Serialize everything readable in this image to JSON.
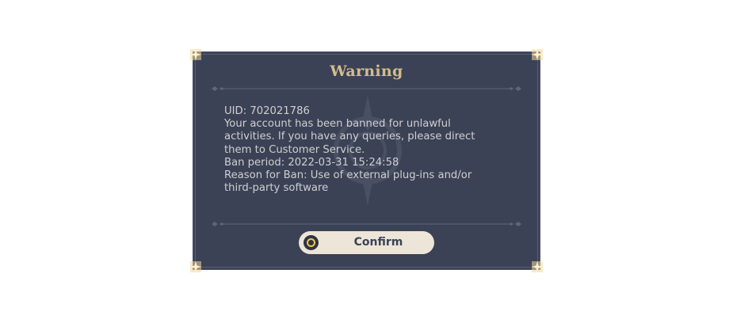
{
  "dialog": {
    "title": "Warning",
    "lines": [
      "UID: 702021786",
      "Your account has been banned for unlawful",
      "activities. If you have any queries, please direct",
      "them to Customer Service.",
      "Ban period: 2022-03-31 15:24:58",
      "Reason for Ban: Use of external plug-ins and/or",
      "third-party software"
    ],
    "confirm_label": "Confirm"
  },
  "colors": {
    "panel": "#3b4256",
    "title": "#d3bc8e",
    "body_text": "#cfcfcf",
    "button_bg": "#ece5d8",
    "button_text": "#3b4256",
    "accent": "#f0c94a"
  },
  "icons": {
    "corners": "corner-star-icon",
    "button": "confirm-circle-icon",
    "background": "emblem-icon"
  }
}
